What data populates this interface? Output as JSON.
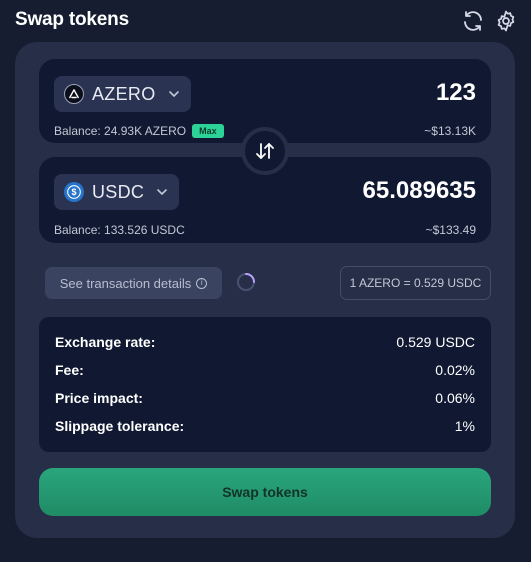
{
  "header": {
    "title": "Swap tokens",
    "icons": [
      "refresh-icon",
      "settings-gear-icon"
    ]
  },
  "from": {
    "token": "AZERO",
    "icon": "azero-logo-icon",
    "amount": "123",
    "balance": "Balance: 24.93K AZERO",
    "max_label": "Max",
    "usd_value": "~$13.13K"
  },
  "to": {
    "token": "USDC",
    "icon": "usdc-logo-icon",
    "amount": "65.089635",
    "balance": "Balance: 133.526 USDC",
    "usd_value": "~$133.49"
  },
  "details_button": {
    "label": "See transaction details",
    "icon": "info-icon"
  },
  "rate_chip": "1 AZERO = 0.529 USDC",
  "info": [
    {
      "label": "Exchange rate:",
      "value": "0.529 USDC"
    },
    {
      "label": "Fee:",
      "value": "0.02%"
    },
    {
      "label": "Price impact:",
      "value": "0.06%"
    },
    {
      "label": "Slippage tolerance:",
      "value": "1%"
    }
  ],
  "swap_button": "Swap tokens",
  "colors": {
    "background": "#161d31",
    "panel": "#262e48",
    "card": "#111932",
    "accent_green": "#2bd399",
    "button_green": "#2aa67c"
  }
}
